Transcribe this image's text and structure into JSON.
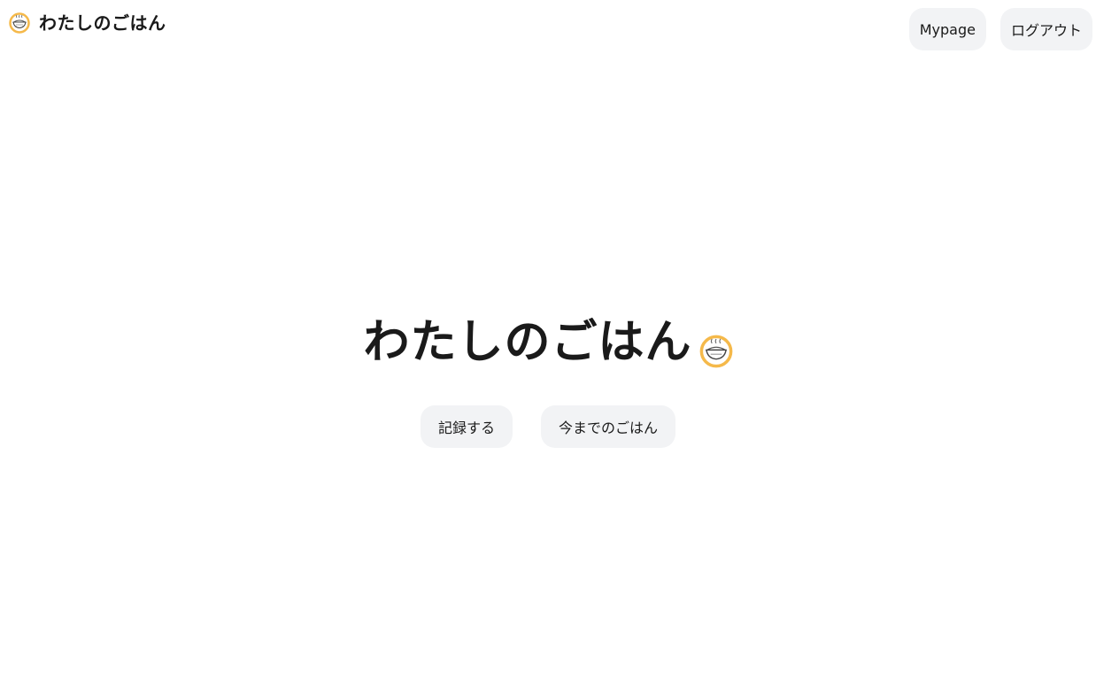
{
  "header": {
    "brand_title": "わたしのごはん",
    "brand_icon": "rice-bowl-icon",
    "nav": {
      "mypage_label": "Mypage",
      "logout_label": "ログアウト"
    }
  },
  "hero": {
    "title": "わたしのごはん",
    "icon": "rice-bowl-icon"
  },
  "actions": {
    "record_label": "記録する",
    "history_label": "今までのごはん"
  },
  "colors": {
    "accent": "#f5b94a",
    "button_bg": "#f2f3f5",
    "text": "#1a1a1a"
  }
}
